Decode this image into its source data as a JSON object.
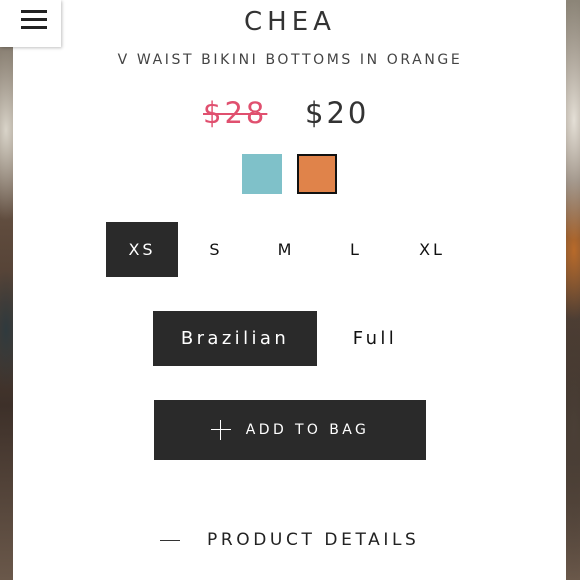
{
  "header": {
    "brand": "CHEA",
    "subtitle": "V WAIST BIKINI BOTTOMS IN ORANGE",
    "menu_icon": "hamburger-menu-icon"
  },
  "price": {
    "original": "$28",
    "sale": "$20",
    "original_color": "#e0506f"
  },
  "colors": [
    {
      "swatch": "#7fc1c9",
      "selected": false
    },
    {
      "swatch": "#e0834a",
      "selected": true
    }
  ],
  "sizes": {
    "options": [
      "XS",
      "S",
      "M",
      "L",
      "XL"
    ],
    "selected": "XS"
  },
  "cuts": {
    "options": [
      "Brazilian",
      "Full"
    ],
    "selected": "Brazilian"
  },
  "actions": {
    "add_to_bag": "ADD TO BAG",
    "add_icon": "plus-icon",
    "product_details": "PRODUCT DETAILS",
    "details_icon": "minus-icon"
  },
  "theme": {
    "dark_button": "#2a2a2a",
    "text": "#333333"
  }
}
